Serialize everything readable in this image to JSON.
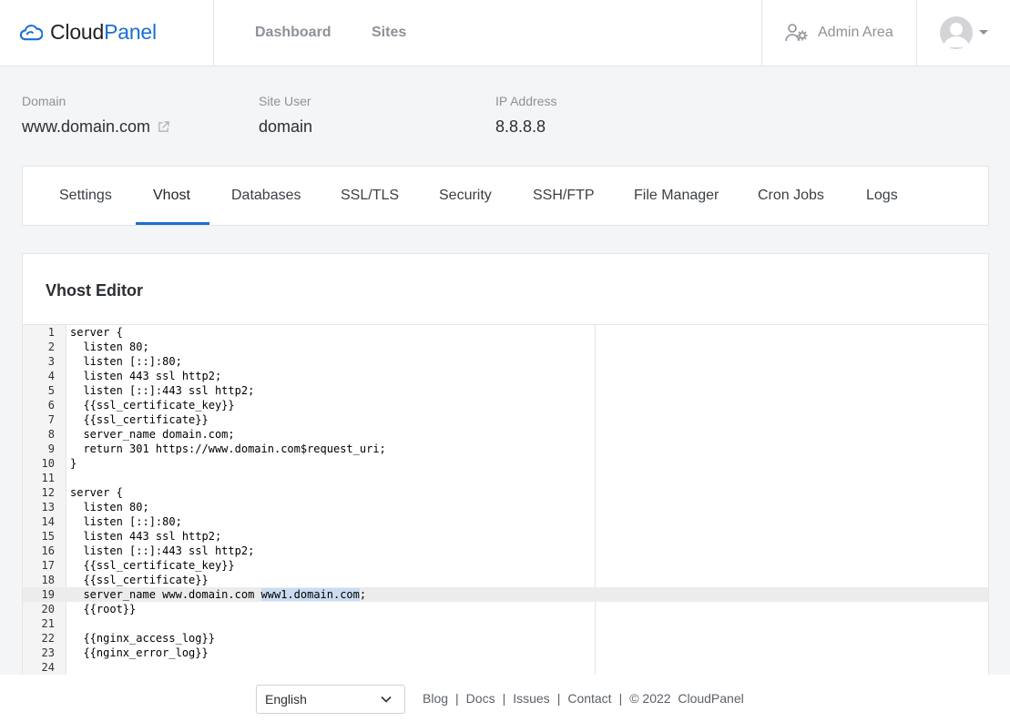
{
  "brand": {
    "name_part1": "Cloud",
    "name_part2": "Panel",
    "brand_color": "#1a6fd1"
  },
  "topnav": {
    "dashboard": "Dashboard",
    "sites": "Sites",
    "admin": "Admin Area"
  },
  "site_info": {
    "domain_label": "Domain",
    "domain_value": "www.domain.com",
    "user_label": "Site User",
    "user_value": "domain",
    "ip_label": "IP Address",
    "ip_value": "8.8.8.8"
  },
  "tabs": [
    "Settings",
    "Vhost",
    "Databases",
    "SSL/TLS",
    "Security",
    "SSH/FTP",
    "File Manager",
    "Cron Jobs",
    "Logs"
  ],
  "active_tab": "Vhost",
  "editor": {
    "title": "Vhost Editor",
    "active_line": 19,
    "lines": [
      "server {",
      "  listen 80;",
      "  listen [::]:80;",
      "  listen 443 ssl http2;",
      "  listen [::]:443 ssl http2;",
      "  {{ssl_certificate_key}}",
      "  {{ssl_certificate}}",
      "  server_name domain.com;",
      "  return 301 https://www.domain.com$request_uri;",
      "}",
      "",
      "server {",
      "  listen 80;",
      "  listen [::]:80;",
      "  listen 443 ssl http2;",
      "  listen [::]:443 ssl http2;",
      "  {{ssl_certificate_key}}",
      "  {{ssl_certificate}}",
      "  server_name www.domain.com www1.domain.com;",
      "  {{root}}",
      "",
      "  {{nginx_access_log}}",
      "  {{nginx_error_log}}",
      ""
    ],
    "selection": {
      "line": 19,
      "text": "www1.domain.com"
    }
  },
  "footer": {
    "language": "English",
    "links": [
      "Blog",
      "Docs",
      "Issues",
      "Contact"
    ],
    "copyright": "© 2022  CloudPanel"
  }
}
